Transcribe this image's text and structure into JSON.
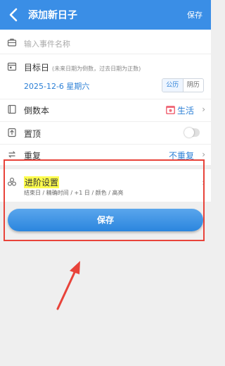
{
  "appbar": {
    "title": "添加新日子",
    "save_label": "保存"
  },
  "form": {
    "event_name_placeholder": "输入事件名称",
    "target_label": "目标日",
    "target_hint": "(未来日期为倒数，过去日期为正数)",
    "date_value": "2025-12-6 星期六",
    "calendar_options": [
      "公历",
      "阴历"
    ],
    "calendar_selected": "公历",
    "book_label": "倒数本",
    "book_value": "生活",
    "pin_label": "置顶",
    "pin_enabled": false,
    "repeat_label": "重复",
    "repeat_value": "不重复"
  },
  "advanced": {
    "title": "进阶设置",
    "subtitle": "结束日 / 精确时间 / +1 日 / 颜色 / 高亮"
  },
  "save_button": {
    "label": "保存"
  },
  "colors": {
    "appbar": "#3a8ee6",
    "accent": "#2b7fd6",
    "highlight": "#fdfc4e",
    "annotation": "#e8433a"
  },
  "icons": [
    "back-arrow-icon",
    "briefcase-icon",
    "calendar-icon",
    "book-icon",
    "pin-icon",
    "repeat-icon",
    "gear-cluster-icon",
    "chevron-right-icon",
    "life-calendar-icon"
  ]
}
